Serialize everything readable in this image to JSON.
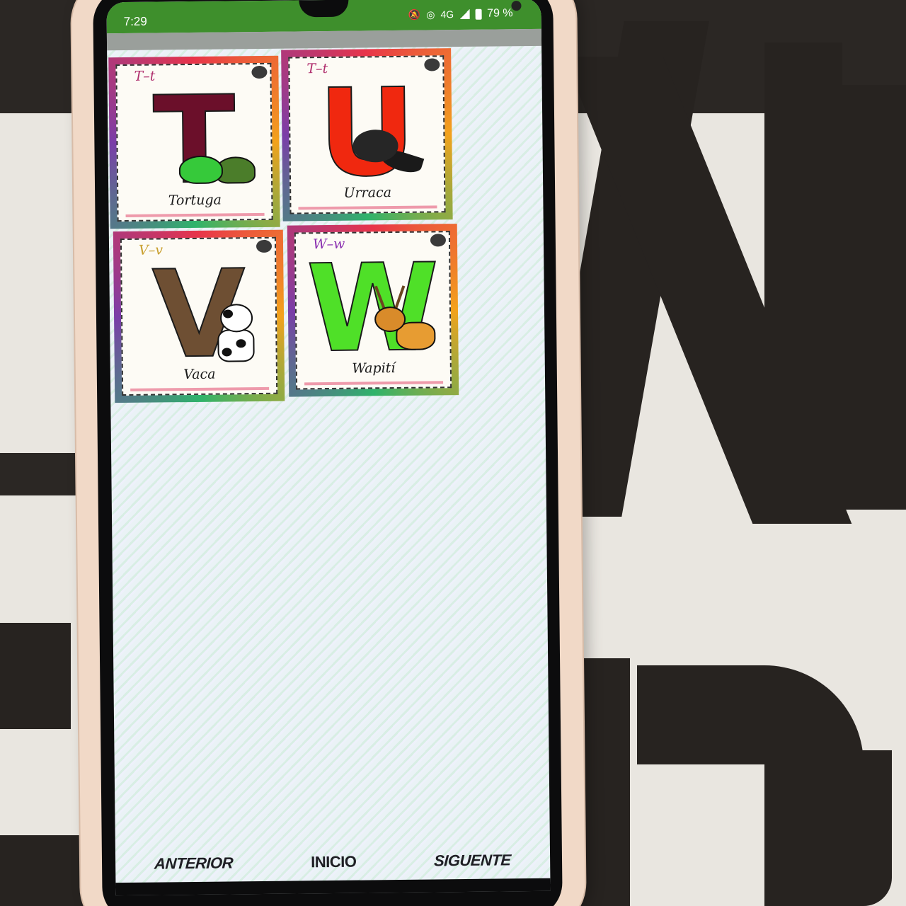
{
  "status_bar": {
    "time": "7:29",
    "network": "4G",
    "battery": "79 %"
  },
  "cards": [
    {
      "letter_label": "T–t",
      "big_letter": "T",
      "letter_color": "#6b0f2a",
      "label_color": "#b0306e",
      "word": "Tortuga",
      "animal": "turtle-icon"
    },
    {
      "letter_label": "T–t",
      "big_letter": "U",
      "letter_color": "#f0280f",
      "label_color": "#b0306e",
      "word": "Urraca",
      "animal": "raven-icon"
    },
    {
      "letter_label": "V–v",
      "big_letter": "V",
      "letter_color": "#6e4f33",
      "label_color": "#c9a030",
      "word": "Vaca",
      "animal": "cow-icon"
    },
    {
      "letter_label": "W–w",
      "big_letter": "W",
      "letter_color": "#4fe028",
      "label_color": "#8a2fb0",
      "word": "Wapití",
      "animal": "deer-icon"
    }
  ],
  "nav": {
    "prev": "ANTERIOR",
    "home": "INICIO",
    "next": "SIGUENTE"
  }
}
